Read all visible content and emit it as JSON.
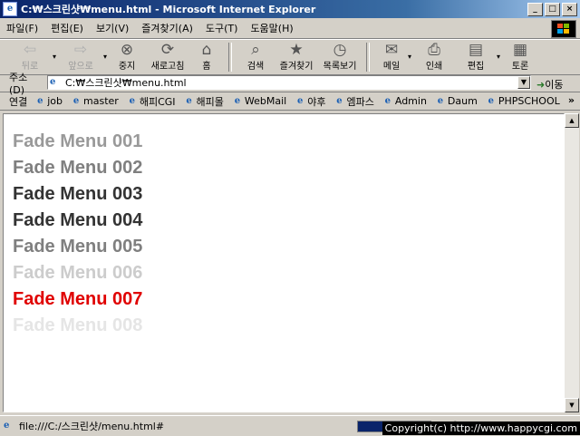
{
  "window": {
    "title": "C:₩스크린샷₩menu.html - Microsoft Internet Explorer",
    "app_icon": "ie-icon",
    "controls": [
      "_",
      "□",
      "×"
    ]
  },
  "menubar": {
    "items": [
      "파일(F)",
      "편집(E)",
      "보기(V)",
      "즐겨찾기(A)",
      "도구(T)",
      "도움말(H)"
    ]
  },
  "toolbar": {
    "back": "뒤로",
    "forward": "앞으로",
    "stop": "중지",
    "refresh": "새로고침",
    "home": "홈",
    "search": "검색",
    "favorites": "즐겨찾기",
    "history": "목록보기",
    "mail": "메일",
    "print": "인쇄",
    "edit": "편집",
    "discuss": "토론"
  },
  "address": {
    "label": "주소(D)",
    "value": "C:₩스크린샷₩menu.html",
    "go": "이동"
  },
  "links": {
    "label": "연결",
    "items": [
      "job",
      "master",
      "해피CGI",
      "해피몰",
      "WebMail",
      "야후",
      "엠파스",
      "Admin",
      "Daum",
      "PHPSCHOOL"
    ],
    "more": "»"
  },
  "page": {
    "menu_items": [
      {
        "label": "Fade Menu 001",
        "color": "#999999"
      },
      {
        "label": "Fade Menu 002",
        "color": "#7f7f7f"
      },
      {
        "label": "Fade Menu 003",
        "color": "#333333"
      },
      {
        "label": "Fade Menu 004",
        "color": "#333333"
      },
      {
        "label": "Fade Menu 005",
        "color": "#7f7f7f"
      },
      {
        "label": "Fade Menu 006",
        "color": "#cccccc"
      },
      {
        "label": "Fade Menu 007",
        "color": "#e00000"
      },
      {
        "label": "Fade Menu 008",
        "color": "#e5e5e5"
      }
    ]
  },
  "statusbar": {
    "text": "file:///C:/스크린샷/menu.html#",
    "progress": 0.55
  },
  "copyright": "Copyright(c) http://www.happycgi.com"
}
